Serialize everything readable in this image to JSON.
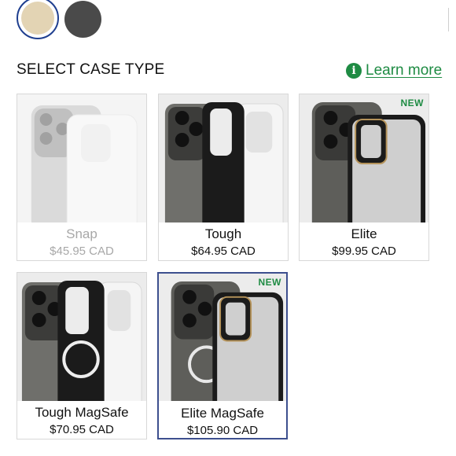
{
  "colors": {
    "gold_swatch": "#e3d4b4",
    "black_swatch": "#4a4a4a",
    "accent_green": "#1e8b43",
    "selected_border": "#3d4f8e",
    "muted_text": "#a8a8a8"
  },
  "swatches": [
    {
      "name": "gold",
      "selected": true
    },
    {
      "name": "black",
      "selected": false
    }
  ],
  "header": {
    "title": "SELECT CASE TYPE",
    "learn_more_label": "Learn more",
    "info_icon": "info-circle-icon",
    "info_glyph": "i"
  },
  "cards": [
    {
      "name": "Snap",
      "price": "$45.95 CAD",
      "badge": "",
      "state": "disabled"
    },
    {
      "name": "Tough",
      "price": "$64.95 CAD",
      "badge": "",
      "state": "default"
    },
    {
      "name": "Elite",
      "price": "$99.95 CAD",
      "badge": "NEW",
      "state": "default"
    },
    {
      "name": "Tough MagSafe",
      "price": "$70.95 CAD",
      "badge": "",
      "state": "default"
    },
    {
      "name": "Elite MagSafe",
      "price": "$105.90 CAD",
      "badge": "NEW",
      "state": "selected"
    }
  ]
}
